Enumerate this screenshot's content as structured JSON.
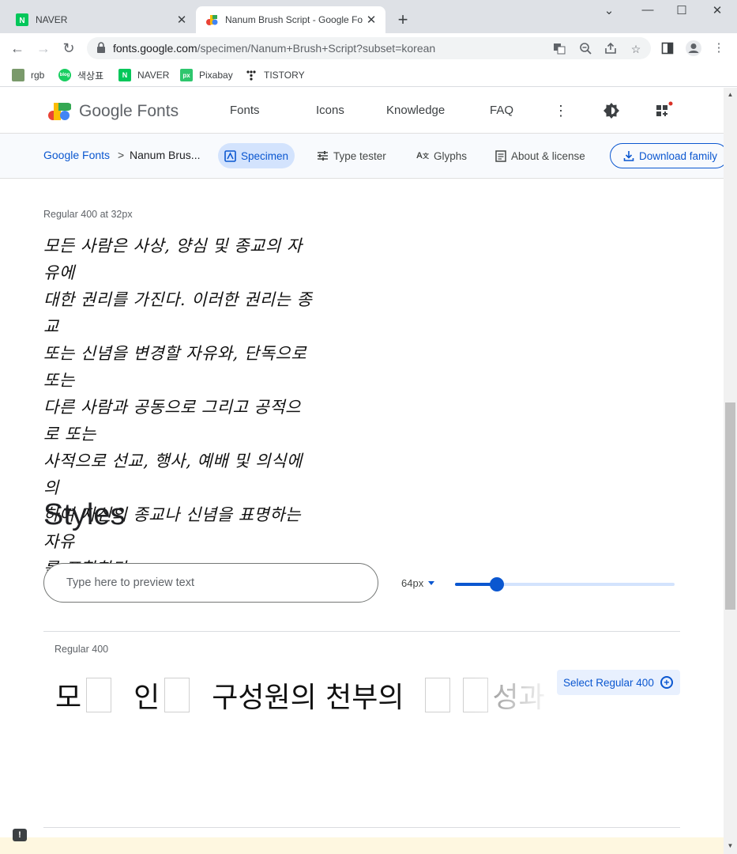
{
  "tabs": [
    {
      "title": "NAVER",
      "active": false
    },
    {
      "title": "Nanum Brush Script - Google Fo",
      "active": true
    }
  ],
  "new_tab_symbol": "+",
  "address_bar": {
    "url_host": "fonts.google.com",
    "url_rest": "/specimen/Nanum+Brush+Script?subset=korean"
  },
  "bookmarks": [
    "rgb",
    "색상표",
    "NAVER",
    "Pixabay",
    "TISTORY"
  ],
  "header": {
    "logo_text": "Google Fonts",
    "nav": [
      "Fonts",
      "Icons",
      "Knowledge",
      "FAQ"
    ]
  },
  "subnav": {
    "crumb_root": "Google Fonts",
    "crumb_sep": ">",
    "crumb_current": "Nanum Brus...",
    "tabs": [
      "Specimen",
      "Type tester",
      "Glyphs",
      "About & license"
    ],
    "active_tab": "Specimen",
    "download_label": "Download family"
  },
  "specimen": {
    "size_label": "Regular 400 at 32px",
    "sample_lines": [
      "모든 사람은 사상, 양심 및 종교의 자유에",
      "대한 권리를 가진다. 이러한 권리는 종교",
      "또는 신념을 변경할 자유와, 단독으로 또는",
      "다른 사람과 공동으로 그리고 공적으로 또는",
      "사적으로 선교, 행사, 예배 및 의식에 의",
      "하여 자신의 종교나 신념을 표명하는 자유",
      "를 포함한다."
    ]
  },
  "styles": {
    "heading": "Styles",
    "input_placeholder": "Type here to preview text",
    "size_value": "64px",
    "slider_fraction": 0.19,
    "rows": [
      {
        "name": "Regular 400",
        "preview_parts": [
          "모",
          "",
          "인",
          "",
          "구성원의 천부의",
          "",
          "",
          "성과"
        ],
        "select_label": "Select Regular 400"
      }
    ]
  },
  "colors": {
    "accent": "#0b57d0",
    "tab_bar": "#dee1e6",
    "subbar": "#f8fafd"
  }
}
